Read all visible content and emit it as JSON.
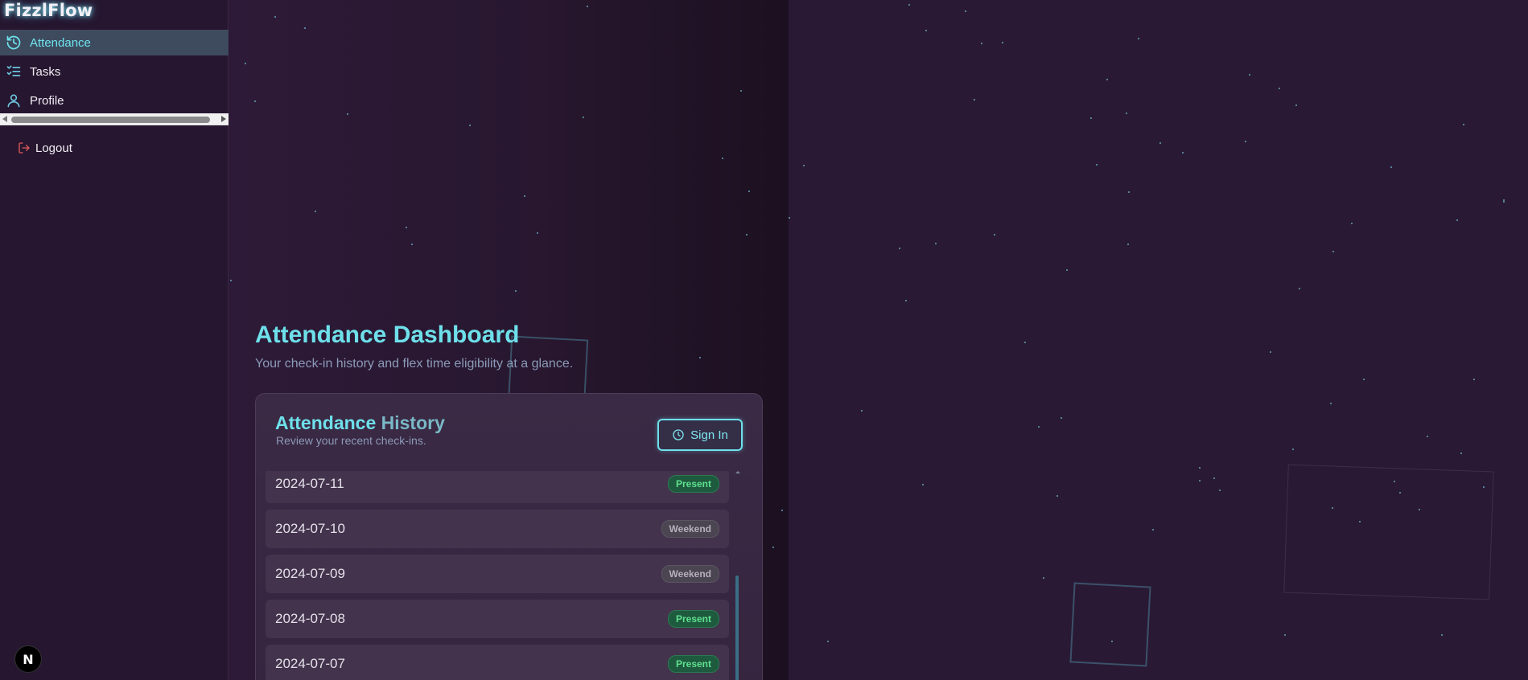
{
  "app": {
    "name": "FizzlFlow"
  },
  "sidebar": {
    "items": [
      {
        "label": "Attendance",
        "icon": "history-icon",
        "active": true
      },
      {
        "label": "Tasks",
        "icon": "list-checks-icon",
        "active": false
      },
      {
        "label": "Profile",
        "icon": "user-icon",
        "active": false
      }
    ],
    "logout_label": "Logout"
  },
  "dashboard": {
    "title": "Attendance Dashboard",
    "subtitle": "Your check-in history and flex time eligibility at a glance."
  },
  "history": {
    "title_part1": "Attendance",
    "title_part2": "History",
    "subtitle": "Review your recent check-ins.",
    "signin_label": "Sign In",
    "rows": [
      {
        "date": "2024-07-11",
        "status": "Present"
      },
      {
        "date": "2024-07-10",
        "status": "Weekend"
      },
      {
        "date": "2024-07-09",
        "status": "Weekend"
      },
      {
        "date": "2024-07-08",
        "status": "Present"
      },
      {
        "date": "2024-07-07",
        "status": "Present"
      }
    ]
  },
  "devtools": {
    "badge": "N"
  },
  "colors": {
    "accent": "#6ee0ea",
    "background": "#2a1933",
    "present": "#5fe08e",
    "weekend": "#b5b0bb",
    "logout_icon": "#e05a5a"
  }
}
